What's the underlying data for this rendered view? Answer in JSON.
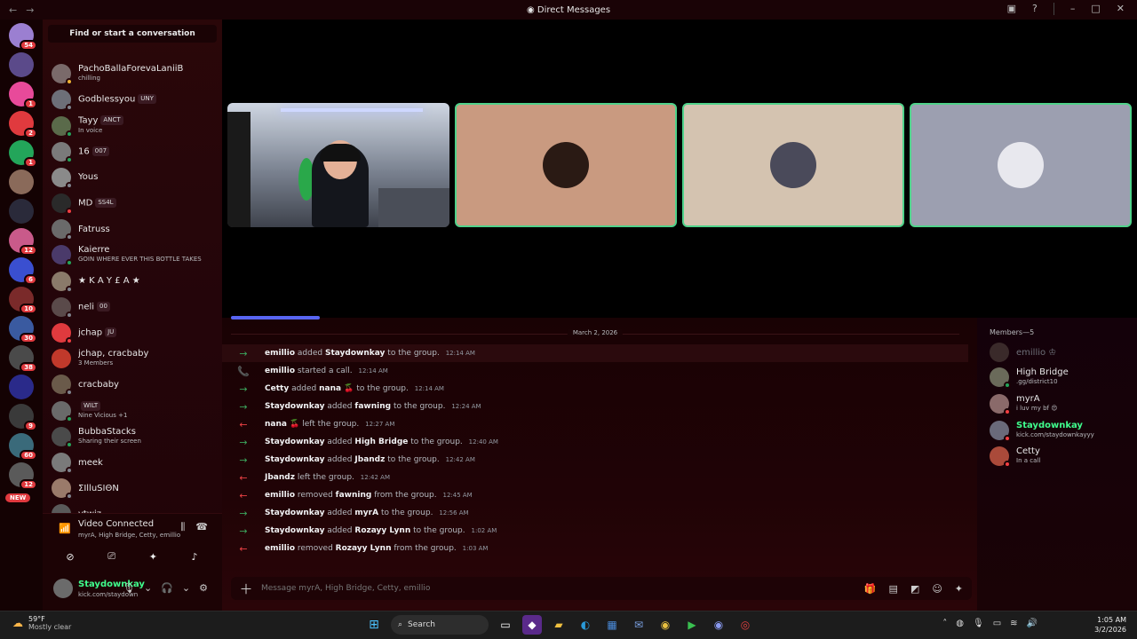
{
  "window": {
    "title": "Direct Messages"
  },
  "sidebar": {
    "finder_label": "Find or start a conversation",
    "servers": [
      {
        "badge": "54",
        "color": "#9b7fd1"
      },
      {
        "badge": "",
        "color": "#5b4a8a"
      },
      {
        "badge": "1",
        "color": "#e84a9a"
      },
      {
        "badge": "2",
        "color": "#e03a3e"
      },
      {
        "badge": "1",
        "color": "#23a55a"
      },
      {
        "badge": "",
        "color": "#8a6a5a"
      },
      {
        "badge": "",
        "color": "#2a2a3a"
      },
      {
        "badge": "12",
        "color": "#c95a8a"
      },
      {
        "badge": "6",
        "color": "#3a4fd0"
      },
      {
        "badge": "10",
        "color": "#7a2a2a"
      },
      {
        "badge": "30",
        "color": "#3a5aa0"
      },
      {
        "badge": "38",
        "color": "#4a4a4a"
      },
      {
        "badge": "",
        "color": "#2a2a8a"
      },
      {
        "badge": "9",
        "color": "#3a3a3a"
      },
      {
        "badge": "60",
        "color": "#3a6a7a"
      },
      {
        "badge": "12",
        "color": "#5a5a5a"
      }
    ],
    "new_label": "NEW",
    "dms": [
      {
        "name": "PachoBallaForevaLaniiB",
        "tag": "",
        "sub": "chilling",
        "avatar": "#7a6a6a",
        "status": "#f0b232"
      },
      {
        "name": "Godblessyou",
        "tag": "UNY",
        "sub": "",
        "avatar": "#6d6f78",
        "status": "#80848e"
      },
      {
        "name": "Tayy",
        "tag": "ANCT",
        "sub": "In voice",
        "avatar": "#5a6a4a",
        "status": "#23a55a"
      },
      {
        "name": "16",
        "tag": "007",
        "sub": "",
        "avatar": "#7a7a7a",
        "status": "#23a55a"
      },
      {
        "name": "Yous",
        "tag": "",
        "sub": "",
        "avatar": "#8a8a8a",
        "status": "#80848e"
      },
      {
        "name": "MD",
        "tag": "SS4L",
        "sub": "",
        "avatar": "#2a2a2a",
        "status": "#f23f43"
      },
      {
        "name": "Fatruss",
        "tag": "",
        "sub": "",
        "avatar": "#6a6a6a",
        "status": "#80848e"
      },
      {
        "name": "Kaierre",
        "tag": "",
        "sub": "GOIN WHERE EVER THIS BOTTLE TAKES",
        "avatar": "#4a3a6a",
        "status": "#23a55a"
      },
      {
        "name": "★ K A Y £ A ★",
        "tag": "",
        "sub": "",
        "avatar": "#8a7a6a",
        "status": "#80848e"
      },
      {
        "name": "neli",
        "tag": "00",
        "sub": "",
        "avatar": "#5a4a4a",
        "status": "#80848e"
      },
      {
        "name": "jchap",
        "tag": "JU",
        "sub": "",
        "avatar": "#e03a3e",
        "status": "#f23f43"
      },
      {
        "name": "jchap, cracbaby",
        "tag": "",
        "sub": "3 Members",
        "avatar": "#c0392b",
        "status": ""
      },
      {
        "name": "cracbaby",
        "tag": "",
        "sub": "",
        "avatar": "#6a5a4a",
        "status": "#80848e"
      },
      {
        "name": "",
        "tag": "WILT",
        "sub": "Nine Vicious +1",
        "avatar": "#6a6a6a",
        "status": "#23a55a"
      },
      {
        "name": "BubbaStacks",
        "tag": "",
        "sub": "Sharing their screen",
        "avatar": "#4a4a4a",
        "status": "#23a55a"
      },
      {
        "name": "meek",
        "tag": "",
        "sub": "",
        "avatar": "#7a7a7a",
        "status": "#80848e"
      },
      {
        "name": "ΣIlluSIΘN",
        "tag": "",
        "sub": "",
        "avatar": "#9a7a6a",
        "status": "#80848e"
      },
      {
        "name": "vtwiz",
        "tag": "",
        "sub": "",
        "avatar": "#5a5a5a",
        "status": "#80848e"
      }
    ]
  },
  "voice": {
    "status": "Video Connected",
    "members": "myrA, High Bridge, Cetty, emillio"
  },
  "user": {
    "name": "Staydownkay",
    "status": "kick.com/staydown"
  },
  "call": {
    "tiles": [
      {
        "kind": "video",
        "speaking": false,
        "bg": ""
      },
      {
        "kind": "avatar",
        "speaking": true,
        "bg": "#c99a80",
        "pic": "#2a1a14"
      },
      {
        "kind": "avatar",
        "speaking": true,
        "bg": "#d4c3b0",
        "pic": "#4a4a5a"
      },
      {
        "kind": "avatar",
        "speaking": true,
        "bg": "#9c9fb0",
        "pic": "#e8e8ee"
      }
    ]
  },
  "chat": {
    "date": "March 2, 2026",
    "messages": [
      {
        "type": "in",
        "a": "emillio",
        "v": "added",
        "b": "Staydownkay",
        "r": "to the group.",
        "ts": "12:14 AM"
      },
      {
        "type": "call",
        "a": "emillio",
        "v": "started a call.",
        "b": "",
        "r": "",
        "ts": "12:14 AM"
      },
      {
        "type": "in",
        "a": "Cetty",
        "v": "added",
        "b": "nana 🍒",
        "r": "to the group.",
        "ts": "12:14 AM"
      },
      {
        "type": "in",
        "a": "Staydownkay",
        "v": "added",
        "b": "fawning",
        "r": "to the group.",
        "ts": "12:24 AM"
      },
      {
        "type": "out",
        "a": "nana 🍒",
        "v": "left the group.",
        "b": "",
        "r": "",
        "ts": "12:27 AM"
      },
      {
        "type": "in",
        "a": "Staydownkay",
        "v": "added",
        "b": "High Bridge",
        "r": "to the group.",
        "ts": "12:40 AM"
      },
      {
        "type": "in",
        "a": "Staydownkay",
        "v": "added",
        "b": "Jbandz",
        "r": "to the group.",
        "ts": "12:42 AM"
      },
      {
        "type": "out",
        "a": "Jbandz",
        "v": "left the group.",
        "b": "",
        "r": "",
        "ts": "12:42 AM"
      },
      {
        "type": "out",
        "a": "emillio",
        "v": "removed",
        "b": "fawning",
        "r": "from the group.",
        "ts": "12:45 AM"
      },
      {
        "type": "in",
        "a": "Staydownkay",
        "v": "added",
        "b": "myrA",
        "r": "to the group.",
        "ts": "12:56 AM"
      },
      {
        "type": "in",
        "a": "Staydownkay",
        "v": "added",
        "b": "Rozayy Lynn",
        "r": "to the group.",
        "ts": "1:02 AM"
      },
      {
        "type": "out",
        "a": "emillio",
        "v": "removed",
        "b": "Rozayy Lynn",
        "r": "from the group.",
        "ts": "1:03 AM"
      }
    ],
    "placeholder": "Message myrA, High Bridge, Cetty, emillio"
  },
  "members": {
    "header": "Members—5",
    "list": [
      {
        "name": "emillio ♔",
        "sub": "",
        "avatar": "#3a2a2a",
        "status": "",
        "color": "#6d6f78"
      },
      {
        "name": "High Bridge",
        "sub": ".gg/district10",
        "avatar": "#6a6a5a",
        "status": "#23a55a",
        "color": "#e8e8e8"
      },
      {
        "name": "myrA",
        "sub": "i luv my bf 😍",
        "avatar": "#8a6a6a",
        "status": "#f23f43",
        "color": "#e8e8e8"
      },
      {
        "name": "Staydownkay",
        "sub": "kick.com/staydownkayyy",
        "avatar": "#6a6a7a",
        "status": "#f23f43",
        "color": "#3fff8d"
      },
      {
        "name": "Cetty",
        "sub": "In a call",
        "avatar": "#aa4a3a",
        "status": "#f23f43",
        "color": "#e8e8e8"
      }
    ]
  },
  "taskbar": {
    "weather_temp": "59°F",
    "weather_desc": "Mostly clear",
    "search_label": "Search",
    "time": "1:05 AM",
    "date": "3/2/2026"
  }
}
